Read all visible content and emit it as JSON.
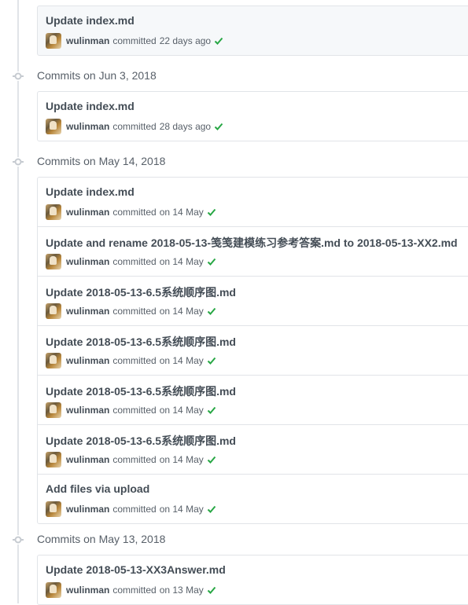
{
  "groups": [
    {
      "title": "",
      "commits": [
        {
          "message": "Update index.md",
          "author": "wulinman",
          "verb": "committed",
          "when": "22 days ago"
        }
      ]
    },
    {
      "title": "Commits on Jun 3, 2018",
      "commits": [
        {
          "message": "Update index.md",
          "author": "wulinman",
          "verb": "committed",
          "when": "28 days ago"
        }
      ]
    },
    {
      "title": "Commits on May 14, 2018",
      "commits": [
        {
          "message": "Update index.md",
          "author": "wulinman",
          "verb": "committed",
          "when": "on 14 May"
        },
        {
          "message": "Update and rename 2018-05-13-笺笺建模练习参考答案.md to 2018-05-13-XX2.md",
          "author": "wulinman",
          "verb": "committed",
          "when": "on 14 May"
        },
        {
          "message": "Update 2018-05-13-6.5系统顺序图.md",
          "author": "wulinman",
          "verb": "committed",
          "when": "on 14 May"
        },
        {
          "message": "Update 2018-05-13-6.5系统顺序图.md",
          "author": "wulinman",
          "verb": "committed",
          "when": "on 14 May"
        },
        {
          "message": "Update 2018-05-13-6.5系统顺序图.md",
          "author": "wulinman",
          "verb": "committed",
          "when": "on 14 May"
        },
        {
          "message": "Update 2018-05-13-6.5系统顺序图.md",
          "author": "wulinman",
          "verb": "committed",
          "when": "on 14 May"
        },
        {
          "message": "Add files via upload",
          "author": "wulinman",
          "verb": "committed",
          "when": "on 14 May"
        }
      ]
    },
    {
      "title": "Commits on May 13, 2018",
      "commits": [
        {
          "message": "Update 2018-05-13-XX3Answer.md",
          "author": "wulinman",
          "verb": "committed",
          "when": "on 13 May"
        }
      ]
    }
  ],
  "colors": {
    "check": "#28a745",
    "border": "#e1e4e8",
    "highlight": "#f6f8fa"
  },
  "icons": {
    "status": "check-icon",
    "timeline": "commit-node-icon",
    "avatar": "avatar"
  }
}
